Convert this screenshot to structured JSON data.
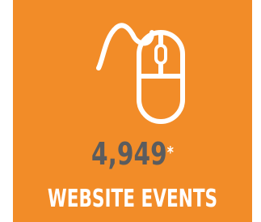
{
  "colors": {
    "tile_background": "#f28c28",
    "stat_number": "#5b5c5e",
    "label_text": "#ffffff",
    "icon_stroke": "#ffffff"
  },
  "icon": "computer-mouse-icon",
  "stat": {
    "value": "4,949",
    "footnote_mark": "*"
  },
  "label": "WEBSITE EVENTS"
}
